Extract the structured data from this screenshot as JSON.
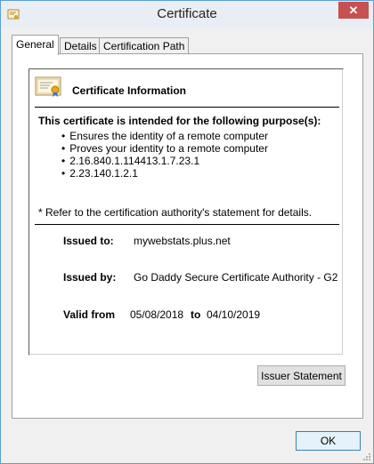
{
  "window": {
    "title": "Certificate",
    "close_glyph": "✕"
  },
  "tabs": [
    {
      "label": "General",
      "active": true
    },
    {
      "label": "Details",
      "active": false
    },
    {
      "label": "Certification Path",
      "active": false
    }
  ],
  "general": {
    "info_title": "Certificate Information",
    "purpose_heading": "This certificate is intended for the following purpose(s):",
    "purposes": [
      "Ensures the identity of a remote computer",
      "Proves your identity to a remote computer",
      "2.16.840.1.114413.1.7.23.1",
      "2.23.140.1.2.1"
    ],
    "note": "* Refer to the certification authority's statement for details.",
    "issued_to_label": "Issued to:",
    "issued_to": "mywebstats.plus.net",
    "issued_by_label": "Issued by:",
    "issued_by": "Go Daddy Secure Certificate Authority - G2",
    "valid_from_label": "Valid from",
    "valid_from": "05/08/2018",
    "valid_to_label": "to",
    "valid_to": "04/10/2019",
    "issuer_statement_button": "Issuer Statement"
  },
  "footer": {
    "ok_button": "OK"
  },
  "icons": {
    "app": "certificate-app-icon",
    "info": "certificate-icon",
    "close": "close-icon",
    "grip": "resize-grip-icon"
  },
  "colors": {
    "close_button": "#c75050",
    "window_border": "#5a9fd6",
    "ok_border": "#3c7fb1"
  }
}
